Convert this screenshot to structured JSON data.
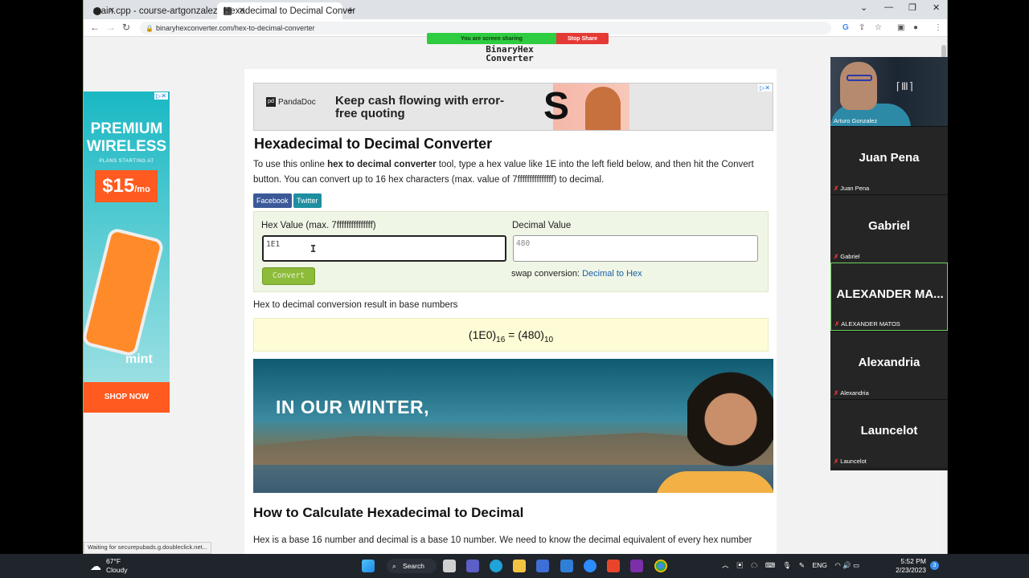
{
  "browser": {
    "tabs": [
      {
        "title": "main.cpp - course-artgonzalezac",
        "active": false
      },
      {
        "title": "Hexadecimal to Decimal Conver",
        "active": true
      }
    ],
    "url": "binaryhexconverter.com/hex-to-decimal-converter"
  },
  "screen_share": {
    "sharing_label": "You are screen sharing",
    "stop_label": "Stop Share"
  },
  "site": {
    "logo_line1": "BinaryHex",
    "logo_line2": "Converter"
  },
  "left_ad": {
    "headline": "PREMIUM WIRELESS",
    "subline": "PLANS STARTING AT",
    "price": "$15",
    "per": "/mo",
    "brand": "mint",
    "cta": "SHOP NOW"
  },
  "top_ad": {
    "brand": "PandaDoc",
    "headline": "Keep cash flowing with error-free quoting"
  },
  "page": {
    "title": "Hexadecimal to Decimal Converter",
    "intro_prefix": "To use this online ",
    "intro_bold": "hex to decimal converter",
    "intro_suffix": " tool, type a hex value like 1E into the left field below, and then hit the Convert button. You can convert up to 16 hex characters (max. value of 7fffffffffffffff) to decimal.",
    "share_facebook": "Facebook",
    "share_twitter": "Twitter"
  },
  "converter": {
    "hex_label": "Hex Value (max. 7fffffffffffffff)",
    "hex_value": "1E1",
    "decimal_label": "Decimal Value",
    "decimal_value": "480",
    "convert_button": "Convert",
    "swap_label": "swap conversion:",
    "swap_link": "Decimal to Hex"
  },
  "result": {
    "label": "Hex to decimal conversion result in base numbers",
    "hex": "1E0",
    "hex_base": "16",
    "decimal": "480",
    "decimal_base": "10"
  },
  "banner_ad": {
    "text": "IN OUR WINTER,"
  },
  "section": {
    "title": "How to Calculate Hexadecimal to Decimal",
    "para": "Hex is a base 16 number and decimal is a base 10 number. We need to know the decimal equivalent of every hex number"
  },
  "status_bar": "Waiting for securepubads.g.doubleclick.net...",
  "zoom": {
    "self_name": "Arturo Gonzalez",
    "participants": [
      {
        "name": "Juan Pena",
        "sub": "Juan Pena"
      },
      {
        "name": "Gabriel",
        "sub": "Gabriel"
      },
      {
        "name": "ALEXANDER MA...",
        "sub": "ALEXANDER MATOS",
        "highlight": true
      },
      {
        "name": "Alexandria",
        "sub": "Alexandria"
      },
      {
        "name": "Launcelot",
        "sub": "Launcelot"
      }
    ]
  },
  "taskbar": {
    "temp": "67°F",
    "weather": "Cloudy",
    "search": "Search",
    "lang": "ENG",
    "time": "5:52 PM",
    "date": "2/23/2023",
    "notifications": "3"
  }
}
